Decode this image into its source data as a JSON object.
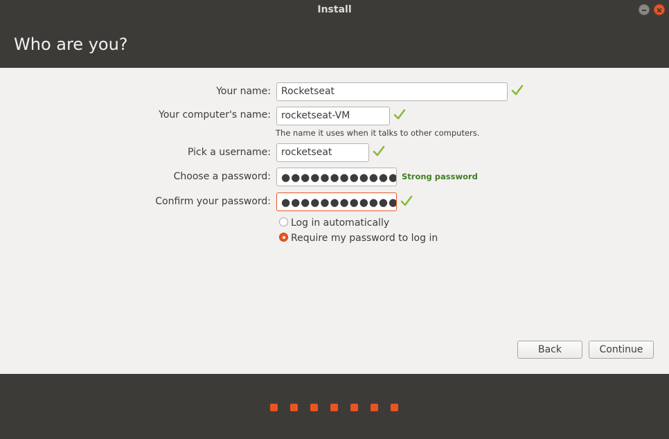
{
  "window": {
    "title": "Install"
  },
  "header": {
    "title": "Who are you?"
  },
  "form": {
    "name_label": "Your name:",
    "name_value": "Rocketseat",
    "computer_label": "Your computer's name:",
    "computer_value": "rocketseat-VM",
    "computer_hint": "The name it uses when it talks to other computers.",
    "username_label": "Pick a username:",
    "username_value": "rocketseat",
    "password_label": "Choose a password:",
    "password_mask": "●●●●●●●●●●●●",
    "password_strength": "Strong password",
    "confirm_label": "Confirm your password:",
    "confirm_mask": "●●●●●●●●●●●●",
    "login_auto_label": "Log in automatically",
    "login_require_label": "Require my password to log in",
    "selected_login_option": "Require my password to log in"
  },
  "buttons": {
    "back": "Back",
    "continue": "Continue"
  },
  "progress": {
    "steps": 7
  },
  "colors": {
    "accent": "#e95420",
    "check": "#8ab83a",
    "strength": "#3e7f21",
    "chrome": "#3d3b37"
  },
  "icons": [
    "check-icon",
    "minimize-icon",
    "close-icon",
    "radio-icon"
  ]
}
